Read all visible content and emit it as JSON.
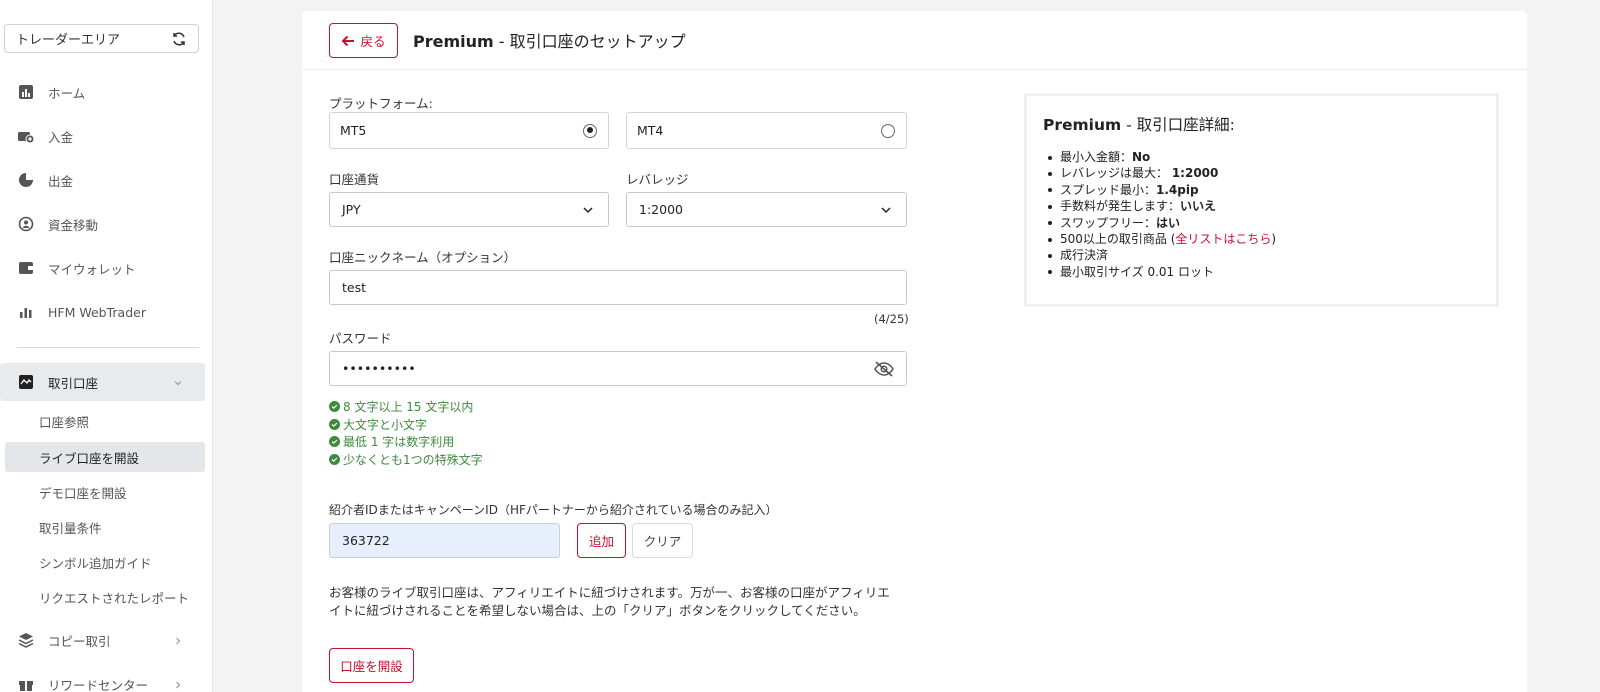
{
  "sidebar": {
    "trader_area": "トレーダーエリア",
    "nav": [
      {
        "label": "ホーム",
        "icon": "chart-icon"
      },
      {
        "label": "入金",
        "icon": "deposit-icon"
      },
      {
        "label": "出金",
        "icon": "withdraw-icon"
      },
      {
        "label": "資金移動",
        "icon": "transfer-icon"
      },
      {
        "label": "マイウォレット",
        "icon": "wallet-icon"
      },
      {
        "label": "HFM WebTrader",
        "icon": "bar-chart-icon"
      }
    ],
    "trading_accounts": "取引口座",
    "sub_items": [
      "口座参照",
      "ライブ口座を開設",
      "デモ口座を開設",
      "取引量条件",
      "シンボル追加ガイド",
      "リクエストされたレポート"
    ],
    "copy_trading": "コピー取引",
    "rewards": "リワードセンター"
  },
  "header": {
    "back": "戻る",
    "title_bold": "Premium",
    "title_rest": " - 取引口座のセットアップ"
  },
  "form": {
    "platform_label": "プラットフォーム:",
    "platform_options": [
      {
        "label": "MT5",
        "selected": true
      },
      {
        "label": "MT4",
        "selected": false
      }
    ],
    "currency_label": "口座通貨",
    "currency_value": "JPY",
    "leverage_label": "レバレッジ",
    "leverage_value": "1:2000",
    "nickname_label": "口座ニックネーム（オプション）",
    "nickname_value": "test",
    "nickname_counter": "(4/25)",
    "password_label": "パスワード",
    "password_value": "••••••••••",
    "password_rules": [
      "8 文字以上 15 文字以内",
      "大文字と小文字",
      "最低 1 字は数字利用",
      "少なくとも1つの特殊文字"
    ],
    "referral_label": "紹介者IDまたはキャンペーンID（HFパートナーから紹介されている場合のみ記入）",
    "referral_value": "363722",
    "add": "追加",
    "clear": "クリア",
    "notice": "お客様のライブ取引口座は、アフィリエイトに紐づけされます。万が一、お客様の口座がアフィリエイトに紐づけされることを希望しない場合は、上の「クリア」ボタンをクリックしてください。",
    "open_account": "口座を開設"
  },
  "details": {
    "title_bold": "Premium",
    "title_rest": " - 取引口座詳細:",
    "items": [
      {
        "text": "最小入金額：",
        "bold": "No"
      },
      {
        "text": "レバレッジは最大： ",
        "bold": "1:2000"
      },
      {
        "text": "スプレッド最小：",
        "bold": "1.4pip"
      },
      {
        "text": "手数料が発生します：",
        "bold": "いいえ"
      },
      {
        "text": "スワップフリー：",
        "bold": "はい"
      },
      {
        "text": "500以上の取引商品 (",
        "link": "全リストはこちら",
        "after": ")"
      },
      {
        "text": "成行決済"
      },
      {
        "text": "最小取引サイズ 0.01 ロット"
      }
    ]
  },
  "colors": {
    "accent": "#c8102e",
    "success": "#3d8b3d",
    "referral_bg": "#e8effc"
  }
}
